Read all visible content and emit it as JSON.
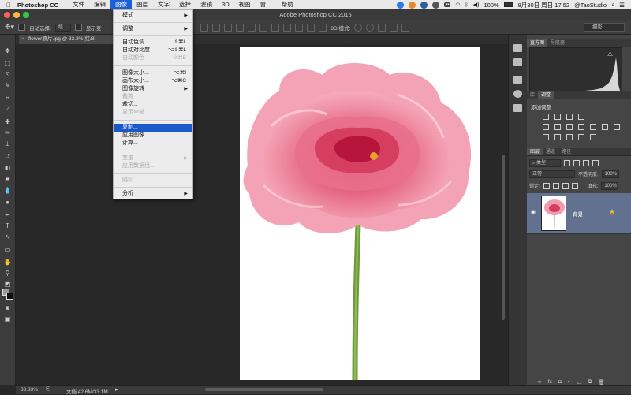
{
  "menubar": {
    "app_name": "Photoshop CC",
    "menus": [
      "文件",
      "编辑",
      "图像",
      "图层",
      "文字",
      "选择",
      "滤镜",
      "3D",
      "视图",
      "窗口",
      "帮助"
    ],
    "active_menu": "图像",
    "battery": "100%",
    "datetime": "8月30日 周日  17 52",
    "user": "@TaoStudio"
  },
  "window": {
    "title": "Adobe Photoshop CC 2015"
  },
  "options_bar": {
    "auto_select_label": "自动选择:",
    "auto_select_value": "组",
    "show_transform_label": "显示变",
    "mode_3d_label": "3D 模式:",
    "workspace_value": "摄影"
  },
  "document_tab": {
    "label": "flower原片.jpg @ 33.3%(红/8)"
  },
  "image_menu": {
    "items": [
      {
        "label": "模式",
        "shortcut": "",
        "submenu": true,
        "disabled": false
      },
      {
        "label": "调整",
        "shortcut": "",
        "submenu": true,
        "disabled": false
      },
      {
        "label": "自动色调",
        "shortcut": "⇧⌘L",
        "submenu": false,
        "disabled": false
      },
      {
        "label": "自动对比度",
        "shortcut": "⌥⇧⌘L",
        "submenu": false,
        "disabled": false
      },
      {
        "label": "自动颜色",
        "shortcut": "⇧⌘B",
        "submenu": false,
        "disabled": true
      },
      {
        "label": "图像大小...",
        "shortcut": "⌥⌘I",
        "submenu": false,
        "disabled": false
      },
      {
        "label": "画布大小...",
        "shortcut": "⌥⌘C",
        "submenu": false,
        "disabled": false
      },
      {
        "label": "图像旋转",
        "shortcut": "",
        "submenu": true,
        "disabled": false
      },
      {
        "label": "裁剪",
        "shortcut": "",
        "submenu": false,
        "disabled": true
      },
      {
        "label": "裁切...",
        "shortcut": "",
        "submenu": false,
        "disabled": false
      },
      {
        "label": "显示全部",
        "shortcut": "",
        "submenu": false,
        "disabled": true
      },
      {
        "label": "复制...",
        "shortcut": "",
        "submenu": false,
        "disabled": false,
        "highlighted": true
      },
      {
        "label": "应用图像...",
        "shortcut": "",
        "submenu": false,
        "disabled": false
      },
      {
        "label": "计算...",
        "shortcut": "",
        "submenu": false,
        "disabled": false
      },
      {
        "label": "变量",
        "shortcut": "",
        "submenu": true,
        "disabled": true
      },
      {
        "label": "应用数据组...",
        "shortcut": "",
        "submenu": false,
        "disabled": true
      },
      {
        "label": "陷印...",
        "shortcut": "",
        "submenu": false,
        "disabled": true
      },
      {
        "label": "分析",
        "shortcut": "",
        "submenu": true,
        "disabled": false
      }
    ]
  },
  "panels": {
    "histogram_tabs": [
      "直方图",
      "导航器"
    ],
    "adjust_tabs": [
      "库",
      "调整"
    ],
    "adjust_title": "添加调整",
    "layers_tabs": [
      "图层",
      "通道",
      "路径"
    ],
    "layer_kind": "类型",
    "blend_mode": "正常",
    "opacity_label": "不透明度:",
    "opacity_value": "100%",
    "lock_label": "锁定:",
    "fill_label": "填充:",
    "fill_value": "100%",
    "layer_name": "背景"
  },
  "status": {
    "zoom": "33.33%",
    "doc_info": "文档:42.6M/33.1M"
  },
  "colors": {
    "menu_highlight": "#1b58c9",
    "layer_selected": "#62718f",
    "canvas_bg": "#282828"
  }
}
